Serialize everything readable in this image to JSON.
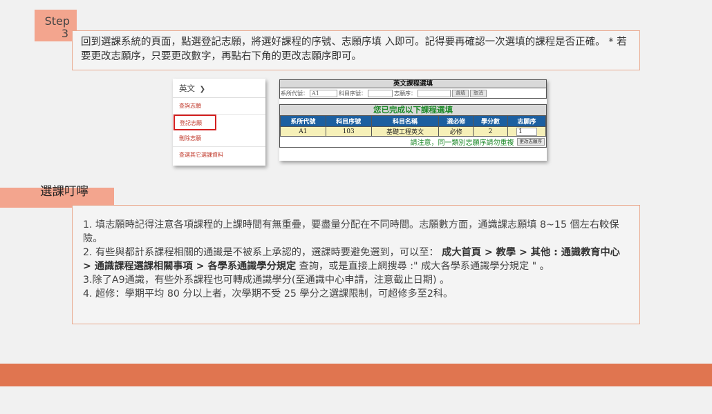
{
  "step": {
    "label": "Step",
    "number": "3",
    "text": "回到選課系統的頁面，點選登記志願，將選好課程的序號、志願序填 入即可。記得要再確認一次選填的課程是否正確。 * 若要更改志願序，只要更改數字，再點右下角的更改志願序即可。"
  },
  "menu": {
    "header": "英文",
    "items": [
      "查詢志願",
      "登記志願",
      "刪除志願",
      "查選其它選課資料"
    ]
  },
  "form": {
    "title": "英文課程選填",
    "dept_label": "系所代號：",
    "dept_value": "A1",
    "course_label": "科目序號：",
    "pref_label": "志願序：",
    "submit": "選填",
    "cancel": "取消",
    "done_title": "您已完成以下課程選填",
    "columns": [
      "系所代號",
      "科目序號",
      "科目名稱",
      "選必修",
      "學分數",
      "志願序"
    ],
    "row": [
      "A1",
      "103",
      "基礎工程英文",
      "必修",
      "2",
      "1"
    ],
    "note": "請注意，同一類別志願序請勿重複",
    "change_btn": "更改志願序"
  },
  "reminders": {
    "title": "選課叮嚀",
    "p1": "1. 填志願時記得注意各項課程的上課時間有無重疊，要盡量分配在不同時間。志願數方面，通識課志願填 8~15 個左右較保險。",
    "p2a": "2. 有些與都計系課程相關的通識是不被系上承認的，選課時要避免選到，可以至： ",
    "p2b": "成大首頁 > 教學 > 其他 : 通識教育中心 > 通識課程選課相關事項 > 各學系通識學分規定",
    "p2c": " 查詢，或是直接上網搜尋 :\" 成大各學系通識學分規定 \" 。",
    "p3": "3.除了A9通識，有些外系課程也可轉成通識學分(至通識中心申請，注意截止日期) 。",
    "p4": "4. 超修：學期平均 80 分以上者，次學期不受 25 學分之選課限制，可超修多至2科。"
  },
  "colors": {
    "accent": "#f3a58e",
    "footer": "#e07550",
    "table_header": "#1c5fa0",
    "green": "#1e8a2a"
  }
}
